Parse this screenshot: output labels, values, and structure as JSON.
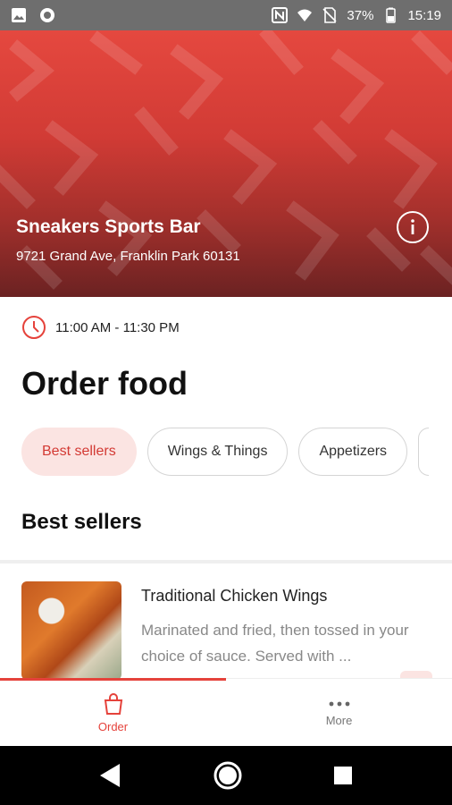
{
  "status_bar": {
    "battery": "37%",
    "time": "15:19"
  },
  "restaurant": {
    "name": "Sneakers Sports Bar",
    "address": "9721 Grand Ave, Franklin Park 60131",
    "hours": "11:00 AM - 11:30 PM"
  },
  "page": {
    "title": "Order food"
  },
  "categories": [
    {
      "label": "Best sellers",
      "active": true
    },
    {
      "label": "Wings & Things",
      "active": false
    },
    {
      "label": "Appetizers",
      "active": false
    }
  ],
  "section": {
    "title": "Best sellers"
  },
  "items": [
    {
      "name": "Traditional Chicken Wings",
      "description": "Marinated and fried, then tossed in your choice of sauce. Served with ..."
    }
  ],
  "bottom_nav": {
    "order_label": "Order",
    "more_label": "More"
  },
  "colors": {
    "accent": "#e5423b",
    "chip_active_bg": "#fbe4e2"
  }
}
